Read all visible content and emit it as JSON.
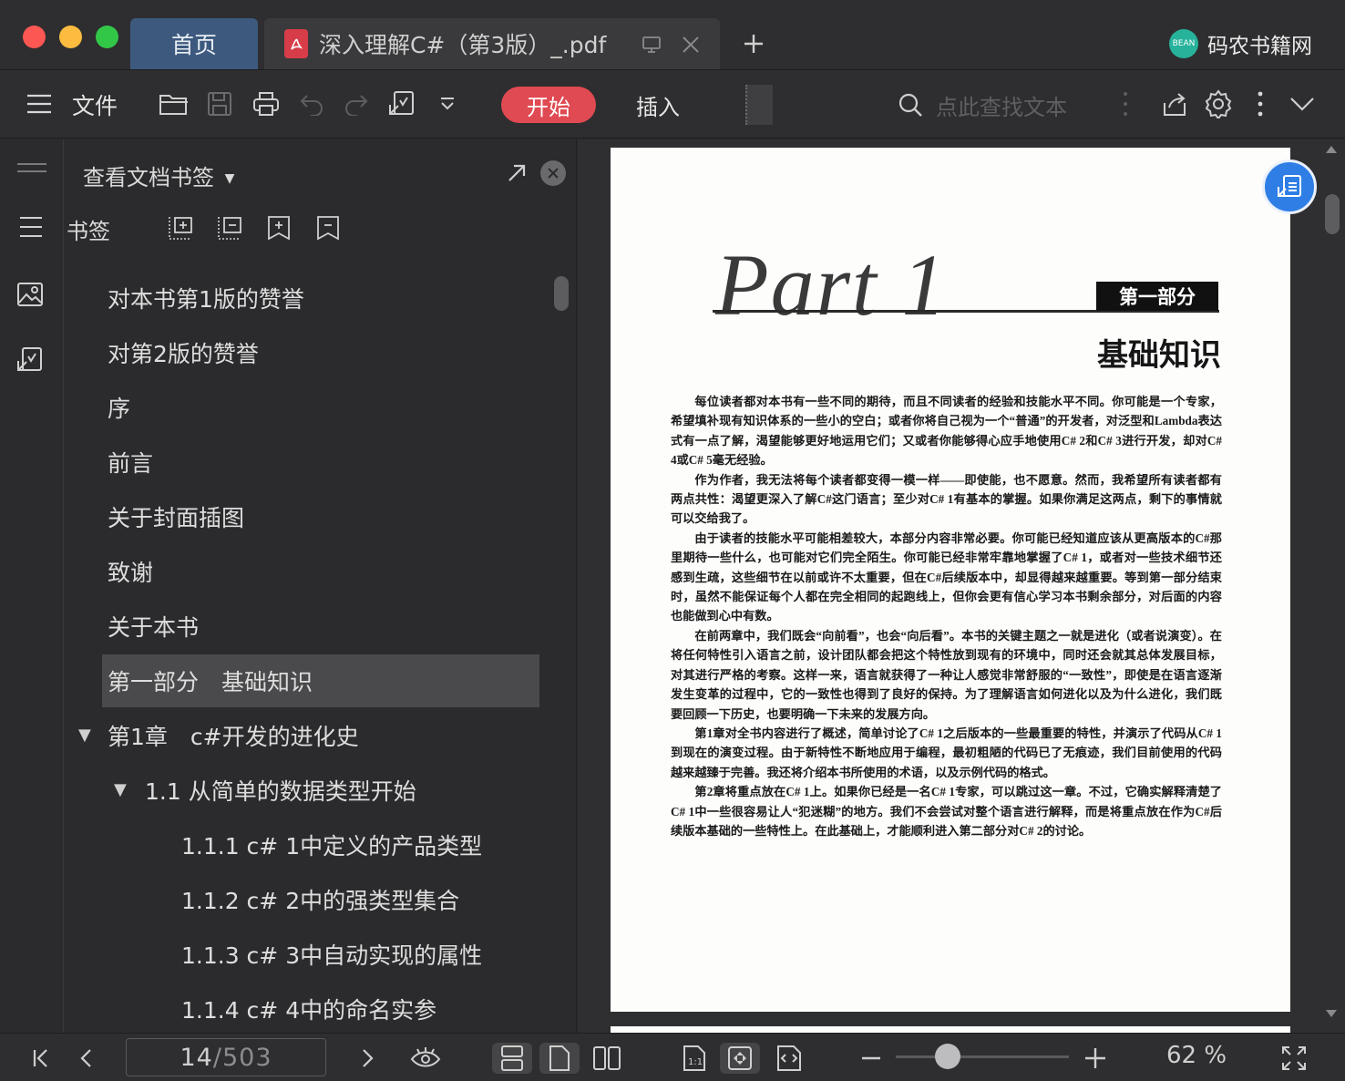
{
  "window": {
    "traffic_lights": {
      "close": "#fc5753",
      "minimize": "#fdbc40",
      "zoom": "#33c748"
    }
  },
  "tabs": [
    {
      "label": "首页",
      "active": false
    },
    {
      "label": "深入理解C#（第3版）_.pdf",
      "active": true
    }
  ],
  "brand": {
    "name": "码农书籍网",
    "logo_text": "BEAN",
    "color": "#27b29b"
  },
  "toolbar": {
    "file_label": "文件",
    "start_label": "开始",
    "insert_label": "插入",
    "search_placeholder": "点此查找文本",
    "accent": "#e04a52"
  },
  "panel": {
    "title": "查看文档书签",
    "bookmarks_label": "书签",
    "items": [
      {
        "label": "对本书第1版的赞誉",
        "level": 0,
        "expanded": null,
        "selected": false
      },
      {
        "label": "对第2版的赞誉",
        "level": 0,
        "expanded": null,
        "selected": false
      },
      {
        "label": "序",
        "level": 0,
        "expanded": null,
        "selected": false
      },
      {
        "label": "前言",
        "level": 0,
        "expanded": null,
        "selected": false
      },
      {
        "label": "关于封面插图",
        "level": 0,
        "expanded": null,
        "selected": false
      },
      {
        "label": "致谢",
        "level": 0,
        "expanded": null,
        "selected": false
      },
      {
        "label": "关于本书",
        "level": 0,
        "expanded": null,
        "selected": false
      },
      {
        "label": "第一部分　基础知识",
        "level": 0,
        "expanded": null,
        "selected": true
      },
      {
        "label": "第1章　c#开发的进化史",
        "level": 0,
        "expanded": true,
        "selected": false
      },
      {
        "label": "1.1 从简单的数据类型开始",
        "level": 1,
        "expanded": true,
        "selected": false
      },
      {
        "label": "1.1.1 c# 1中定义的产品类型",
        "level": 2,
        "expanded": null,
        "selected": false
      },
      {
        "label": "1.1.2 c# 2中的强类型集合",
        "level": 2,
        "expanded": null,
        "selected": false
      },
      {
        "label": "1.1.3 c# 3中自动实现的属性",
        "level": 2,
        "expanded": null,
        "selected": false
      },
      {
        "label": "1.1.4 c# 4中的命名实参",
        "level": 2,
        "expanded": null,
        "selected": false
      }
    ]
  },
  "document": {
    "part_title": "Part 1",
    "part_badge": "第一部分",
    "heading": "基础知识",
    "paragraphs": [
      "每位读者都对本书有一些不同的期待，而且不同读者的经验和技能水平不同。你可能是一个专家，希望填补现有知识体系的一些小的空白；或者你将自己视为一个“普通”的开发者，对泛型和Lambda表达式有一点了解，渴望能够更好地运用它们；又或者你能够得心应手地使用C# 2和C# 3进行开发，却对C# 4或C# 5毫无经验。",
      "作为作者，我无法将每个读者都变得一模一样——即使能，也不愿意。然而，我希望所有读者都有两点共性：渴望更深入了解C#这门语言；至少对C# 1有基本的掌握。如果你满足这两点，剩下的事情就可以交给我了。",
      "由于读者的技能水平可能相差较大，本部分内容非常必要。你可能已经知道应该从更高版本的C#那里期待一些什么，也可能对它们完全陌生。你可能已经非常牢靠地掌握了C# 1，或者对一些技术细节还感到生疏，这些细节在以前或许不太重要，但在C#后续版本中，却显得越来越重要。等到第一部分结束时，虽然不能保证每个人都在完全相同的起跑线上，但你会更有信心学习本书剩余部分，对后面的内容也能做到心中有数。",
      "在前两章中，我们既会“向前看”，也会“向后看”。本书的关键主题之一就是进化（或者说演变）。在将任何特性引入语言之前，设计团队都会把这个特性放到现有的环境中，同时还会就其总体发展目标，对其进行严格的考察。这样一来，语言就获得了一种让人感觉非常舒服的“一致性”，即使是在语言逐渐发生变革的过程中，它的一致性也得到了良好的保持。为了理解语言如何进化以及为什么进化，我们既要回顾一下历史，也要明确一下未来的发展方向。",
      "第1章对全书内容进行了概述，简单讨论了C# 1之后版本的一些最重要的特性，并演示了代码从C# 1到现在的演变过程。由于新特性不断地应用于编程，最初粗陋的代码已了无痕迹，我们目前使用的代码越来越臻于完善。我还将介绍本书所使用的术语，以及示例代码的格式。",
      "第2章将重点放在C# 1上。如果你已经是一名C# 1专家，可以跳过这一章。不过，它确实解释清楚了C# 1中一些很容易让人“犯迷糊”的地方。我们不会尝试对整个语言进行解释，而是将重点放在作为C#后续版本基础的一些特性上。在此基础上，才能顺利进入第二部分对C# 2的讨论。"
    ]
  },
  "statusbar": {
    "current_page": "14",
    "total_pages": "/503",
    "zoom_fraction": 0.3,
    "zoom_label": "62 %"
  }
}
